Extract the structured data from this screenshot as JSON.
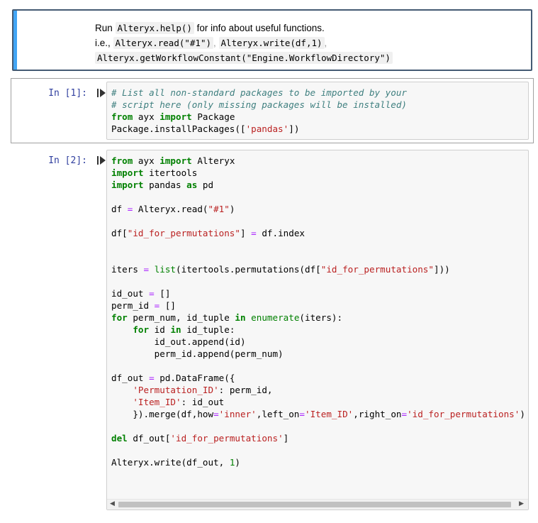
{
  "markdown_cell": {
    "line1_prefix": "Run",
    "line1_code": "Alteryx.help()",
    "line1_suffix": "for info about useful functions.",
    "line2_prefix": "i.e.,",
    "line2_code1": "Alteryx.read(\"#1\")",
    "line2_sep1": ",",
    "line2_code2": "Alteryx.write(df,1)",
    "line2_sep2": ",",
    "line3_code": "Alteryx.getWorkflowConstant(\"Engine.WorkflowDirectory\")"
  },
  "cells": [
    {
      "prompt": "In [1]:",
      "code": [
        "# List all non-standard packages to be imported by your",
        "# script here (only missing packages will be installed)",
        "from ayx import Package",
        "Package.installPackages(['pandas'])"
      ]
    },
    {
      "prompt": "In [2]:",
      "code": [
        "from ayx import Alteryx",
        "import itertools",
        "import pandas as pd",
        "",
        "df = Alteryx.read(\"#1\")",
        "",
        "df[\"id_for_permutations\"] = df.index",
        "",
        "",
        "iters = list(itertools.permutations(df[\"id_for_permutations\"]))",
        "",
        "id_out = []",
        "perm_id = []",
        "for perm_num, id_tuple in enumerate(iters):",
        "    for id in id_tuple:",
        "        id_out.append(id)",
        "        perm_id.append(perm_num)",
        "",
        "df_out = pd.DataFrame({",
        "    'Permutation_ID': perm_id,",
        "    'Item_ID': id_out",
        "    }).merge(df,how='inner',left_on='Item_ID',right_on='id_for_permutations')",
        "",
        "del df_out['id_for_permutations']",
        "",
        "Alteryx.write(df_out, 1)"
      ]
    }
  ],
  "icons": {
    "run": "run-cell-icon",
    "scroll_left": "scroll-left-icon",
    "scroll_right": "scroll-right-icon"
  },
  "colors": {
    "selected_border": "#445a73",
    "selected_bar": "#42a5f5",
    "prompt": "#303f9f",
    "keyword": "#008000",
    "comment": "#408080",
    "string": "#ba2121",
    "operator": "#aa22ff"
  }
}
